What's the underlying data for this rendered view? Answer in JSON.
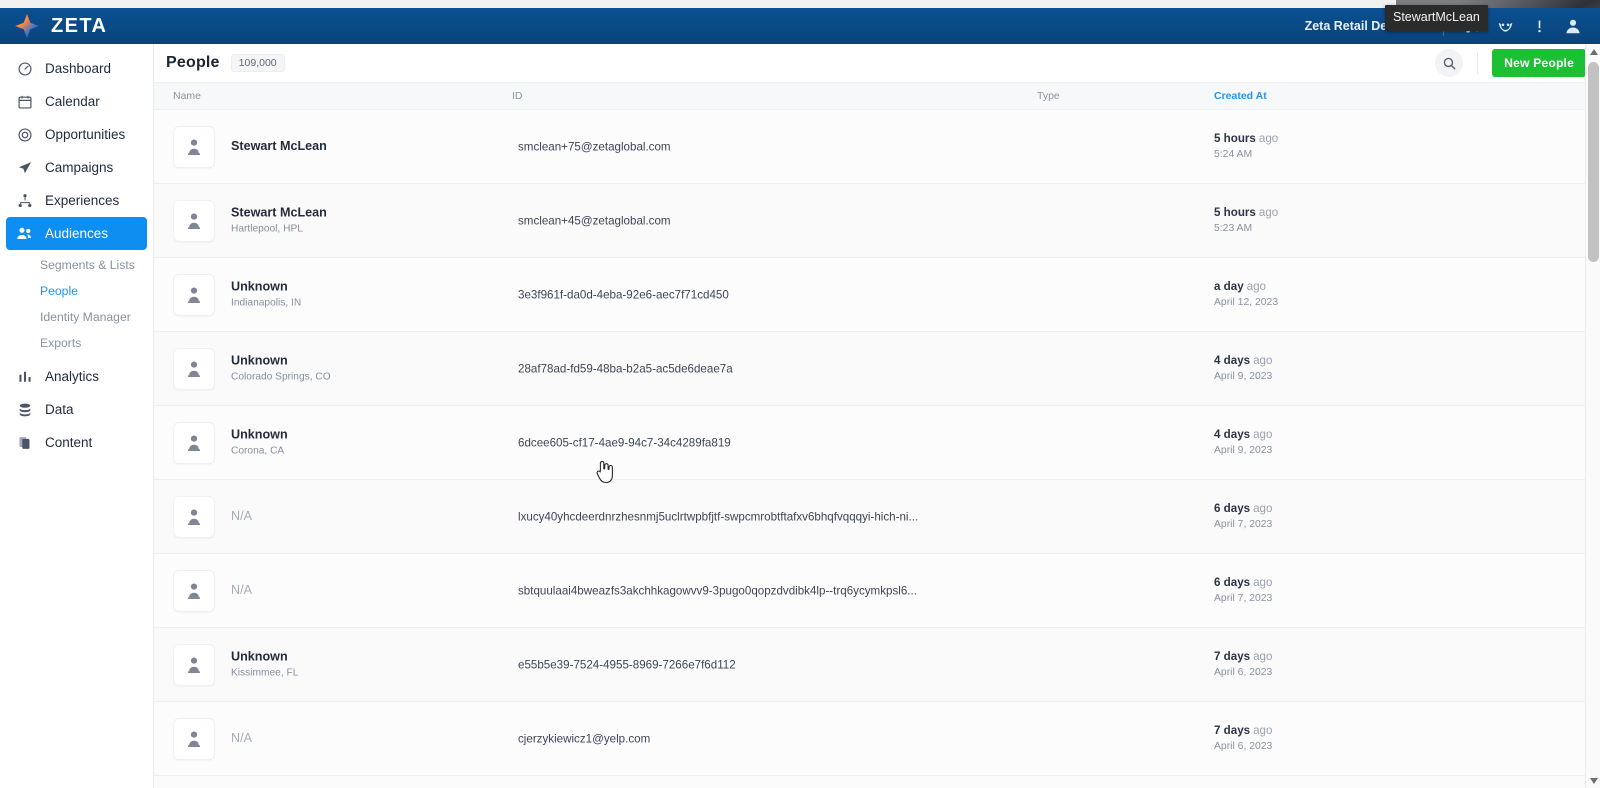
{
  "app": {
    "brand_name": "ZETA",
    "logo_icon": "zeta-diamond-logo"
  },
  "topbar": {
    "org_name": "Zeta Retail Demo",
    "org_chevron_icon": "chevron-down-icon",
    "icons": [
      {
        "name": "announcement-icon",
        "label": "Announcements"
      },
      {
        "name": "owl-support-icon",
        "label": "Support"
      },
      {
        "name": "help-icon",
        "label": "Help"
      },
      {
        "name": "user-avatar-icon",
        "label": "Account"
      }
    ],
    "tooltip": "StewartMcLean"
  },
  "sidebar": {
    "items": [
      {
        "label": "Dashboard",
        "icon": "gauge-icon",
        "active": false
      },
      {
        "label": "Calendar",
        "icon": "calendar-icon",
        "active": false
      },
      {
        "label": "Opportunities",
        "icon": "target-icon",
        "active": false
      },
      {
        "label": "Campaigns",
        "icon": "paper-plane-icon",
        "active": false
      },
      {
        "label": "Experiences",
        "icon": "sitemap-icon",
        "active": false
      },
      {
        "label": "Audiences",
        "icon": "people-icon",
        "active": true
      },
      {
        "label": "Analytics",
        "icon": "bar-chart-icon",
        "active": false
      },
      {
        "label": "Data",
        "icon": "database-icon",
        "active": false
      },
      {
        "label": "Content",
        "icon": "documents-icon",
        "active": false
      }
    ],
    "subnav": [
      {
        "label": "Segments & Lists",
        "active": false
      },
      {
        "label": "People",
        "active": true
      },
      {
        "label": "Identity Manager",
        "active": false
      },
      {
        "label": "Exports",
        "active": false
      }
    ]
  },
  "page": {
    "title": "People",
    "count": "109,000",
    "search_icon": "search-icon",
    "new_button": "New People",
    "new_button_color": "#1dbf34",
    "accent_color": "#2196f3",
    "header_color": "#0a4a86"
  },
  "table": {
    "columns": [
      "Name",
      "ID",
      "Type",
      "Created At"
    ],
    "sorted_column": "Created At",
    "rows": [
      {
        "avatar_icon": "person-icon",
        "name": "Stewart McLean",
        "location": "",
        "id": "smclean+75@zetaglobal.com",
        "type": "",
        "created_relative": "5 hours",
        "created_ago": "ago",
        "created_absolute": "5:24 AM"
      },
      {
        "avatar_icon": "person-icon",
        "name": "Stewart McLean",
        "location": "Hartlepool, HPL",
        "id": "smclean+45@zetaglobal.com",
        "type": "",
        "created_relative": "5 hours",
        "created_ago": "ago",
        "created_absolute": "5:23 AM"
      },
      {
        "avatar_icon": "person-icon",
        "name": "Unknown",
        "location": "Indianapolis, IN",
        "id": "3e3f961f-da0d-4eba-92e6-aec7f71cd450",
        "type": "",
        "created_relative": "a day",
        "created_ago": "ago",
        "created_absolute": "April 12, 2023"
      },
      {
        "avatar_icon": "person-icon",
        "name": "Unknown",
        "location": "Colorado Springs, CO",
        "id": "28af78ad-fd59-48ba-b2a5-ac5de6deae7a",
        "type": "",
        "created_relative": "4 days",
        "created_ago": "ago",
        "created_absolute": "April 9, 2023"
      },
      {
        "avatar_icon": "person-icon",
        "name": "Unknown",
        "location": "Corona, CA",
        "id": "6dcee605-cf17-4ae9-94c7-34c4289fa819",
        "type": "",
        "created_relative": "4 days",
        "created_ago": "ago",
        "created_absolute": "April 9, 2023"
      },
      {
        "avatar_icon": "person-icon",
        "name": "N/A",
        "location": "",
        "id": "lxucy40yhcdeerdnrzhesnmj5uclrtwpbfjtf-swpcmrobtftafxv6bhqfvqqqyi-hich-ni...",
        "type": "",
        "created_relative": "6 days",
        "created_ago": "ago",
        "created_absolute": "April 7, 2023"
      },
      {
        "avatar_icon": "person-icon",
        "name": "N/A",
        "location": "",
        "id": "sbtquulaai4bweazfs3akchhkagowvv9-3pugo0qopzdvdibk4lp--trq6ycymkpsl6...",
        "type": "",
        "created_relative": "6 days",
        "created_ago": "ago",
        "created_absolute": "April 7, 2023"
      },
      {
        "avatar_icon": "person-icon",
        "name": "Unknown",
        "location": "Kissimmee, FL",
        "id": "e55b5e39-7524-4955-8969-7266e7f6d112",
        "type": "",
        "created_relative": "7 days",
        "created_ago": "ago",
        "created_absolute": "April 6, 2023"
      },
      {
        "avatar_icon": "person-icon",
        "name": "N/A",
        "location": "",
        "id": "cjerzykiewicz1@yelp.com",
        "type": "",
        "created_relative": "7 days",
        "created_ago": "ago",
        "created_absolute": "April 6, 2023"
      }
    ]
  },
  "scrollbar": {
    "up_icon": "scroll-up-arrow-icon",
    "down_icon": "scroll-down-arrow-icon"
  },
  "cursor": {
    "icon": "pointer-hand-cursor"
  }
}
